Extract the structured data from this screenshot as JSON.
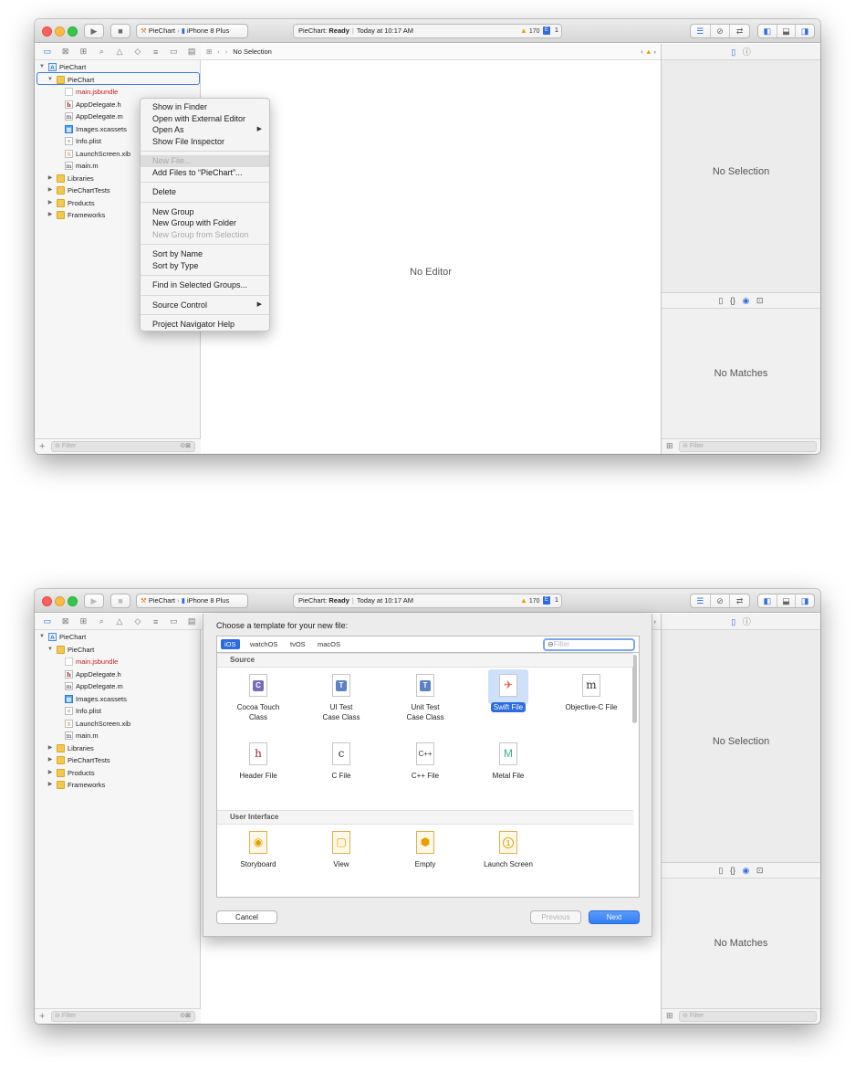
{
  "toolbar": {
    "run_icon": "play-icon",
    "stop_icon": "stop-icon",
    "scheme": "PieChart",
    "device": "iPhone 8 Plus",
    "activity_project": "PieChart:",
    "activity_status": "Ready",
    "activity_time": "Today at 10:17 AM",
    "warning_count": "170",
    "error_count": "1"
  },
  "navigator": {
    "tree": [
      {
        "label": "PieChart",
        "icon": "project",
        "level": 0,
        "open": true
      },
      {
        "label": "PieChart",
        "icon": "folder",
        "level": 1,
        "open": true
      },
      {
        "label": "main.jsbundle",
        "icon": "bundle",
        "level": 2,
        "red": true
      },
      {
        "label": "AppDelegate.h",
        "icon": "h",
        "level": 2
      },
      {
        "label": "AppDelegate.m",
        "icon": "m",
        "level": 2
      },
      {
        "label": "Images.xcassets",
        "icon": "assets",
        "level": 2
      },
      {
        "label": "Info.plist",
        "icon": "plist",
        "level": 2
      },
      {
        "label": "LaunchScreen.xib",
        "icon": "xib",
        "level": 2
      },
      {
        "label": "main.m",
        "icon": "m",
        "level": 2
      },
      {
        "label": "Libraries",
        "icon": "folder",
        "level": 1,
        "open": false
      },
      {
        "label": "PieChartTests",
        "icon": "folder",
        "level": 1,
        "open": false
      },
      {
        "label": "Products",
        "icon": "folder",
        "level": 1,
        "open": false
      },
      {
        "label": "Frameworks",
        "icon": "folder",
        "level": 1,
        "open": false
      }
    ],
    "filter_placeholder": "Filter"
  },
  "editor": {
    "jump_title": "No Selection",
    "empty_text": "No Editor"
  },
  "inspector": {
    "no_selection": "No Selection",
    "no_matches": "No Matches",
    "filter_placeholder": "Filter"
  },
  "context_menu": {
    "groups": [
      [
        {
          "label": "Show in Finder"
        },
        {
          "label": "Open with External Editor"
        },
        {
          "label": "Open As",
          "submenu": true
        },
        {
          "label": "Show File Inspector"
        }
      ],
      [
        {
          "label": "New File...",
          "highlighted": true
        },
        {
          "label": "Add Files to “PieChart”..."
        }
      ],
      [
        {
          "label": "Delete"
        }
      ],
      [
        {
          "label": "New Group"
        },
        {
          "label": "New Group with Folder"
        },
        {
          "label": "New Group from Selection",
          "disabled": true
        }
      ],
      [
        {
          "label": "Sort by Name"
        },
        {
          "label": "Sort by Type"
        }
      ],
      [
        {
          "label": "Find in Selected Groups..."
        }
      ],
      [
        {
          "label": "Source Control",
          "submenu": true
        }
      ],
      [
        {
          "label": "Project Navigator Help"
        }
      ]
    ]
  },
  "template_sheet": {
    "title": "Choose a template for your new file:",
    "platforms": [
      "iOS",
      "watchOS",
      "tvOS",
      "macOS"
    ],
    "selected_platform": "iOS",
    "filter_placeholder": "Filter",
    "sections": [
      {
        "name": "Source",
        "items": [
          {
            "label": "Cocoa Touch\nClass",
            "icon": "cocoa-touch-class-icon",
            "glyph": "C",
            "color": "#7b6bb8"
          },
          {
            "label": "UI Test\nCase Class",
            "icon": "ui-test-case-icon",
            "glyph": "T",
            "color": "#5a82c4"
          },
          {
            "label": "Unit Test\nCase Class",
            "icon": "unit-test-case-icon",
            "glyph": "T",
            "color": "#5a82c4"
          },
          {
            "label": "Swift File",
            "icon": "swift-file-icon",
            "glyph": "✈",
            "color": "#f05138",
            "selected": true
          },
          {
            "label": "Objective-C File",
            "icon": "objc-file-icon",
            "glyph": "m",
            "color": "#333333"
          },
          {
            "label": "Header File",
            "icon": "header-file-icon",
            "glyph": "h",
            "color": "#a0282a"
          },
          {
            "label": "C File",
            "icon": "c-file-icon",
            "glyph": "c",
            "color": "#333333"
          },
          {
            "label": "C++ File",
            "icon": "cpp-file-icon",
            "glyph": "C++",
            "color": "#333333"
          },
          {
            "label": "Metal File",
            "icon": "metal-file-icon",
            "glyph": "M",
            "color": "#2fb58a"
          }
        ]
      },
      {
        "name": "User Interface",
        "items": [
          {
            "label": "Storyboard",
            "icon": "storyboard-icon",
            "glyph": "◉",
            "color": "#e8a000"
          },
          {
            "label": "View",
            "icon": "view-icon",
            "glyph": "▢",
            "color": "#e8a000"
          },
          {
            "label": "Empty",
            "icon": "empty-icon",
            "glyph": "⬢",
            "color": "#e8a000"
          },
          {
            "label": "Launch Screen",
            "icon": "launch-screen-icon",
            "glyph": "1",
            "color": "#e8a000"
          }
        ]
      }
    ],
    "buttons": {
      "cancel": "Cancel",
      "previous": "Previous",
      "next": "Next"
    }
  },
  "colors": {
    "accent": "#2d6be0",
    "warning": "#e8a000"
  }
}
